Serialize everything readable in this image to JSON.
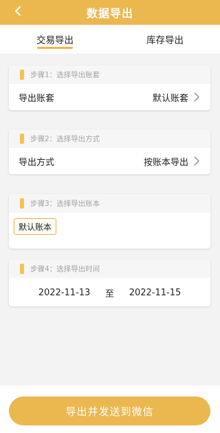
{
  "header": {
    "title": "数据导出"
  },
  "tabs": [
    {
      "label": "交易导出",
      "active": true
    },
    {
      "label": "库存导出",
      "active": false
    }
  ],
  "step1": {
    "title": "步骤1：选择导出账套",
    "label": "导出账套",
    "value": "默认账套"
  },
  "step2": {
    "title": "步骤2：选择导出方式",
    "label": "导出方式",
    "value": "按账本导出"
  },
  "step3": {
    "title": "步骤3：选择导出账本",
    "tag": "默认账本"
  },
  "step4": {
    "title": "步骤4：选择导出时间",
    "start_date": "2022-11-13",
    "separator": "至",
    "end_date": "2022-11-15"
  },
  "footer": {
    "button_label": "导出并发送到微信"
  },
  "colors": {
    "accent": "#ebb74f",
    "step_flag": "#f4c353",
    "background": "#f3f3f3"
  },
  "icons": {
    "back": "chevron-left-icon",
    "row_arrow": "chevron-right-icon",
    "step_flag": "flag-icon"
  }
}
